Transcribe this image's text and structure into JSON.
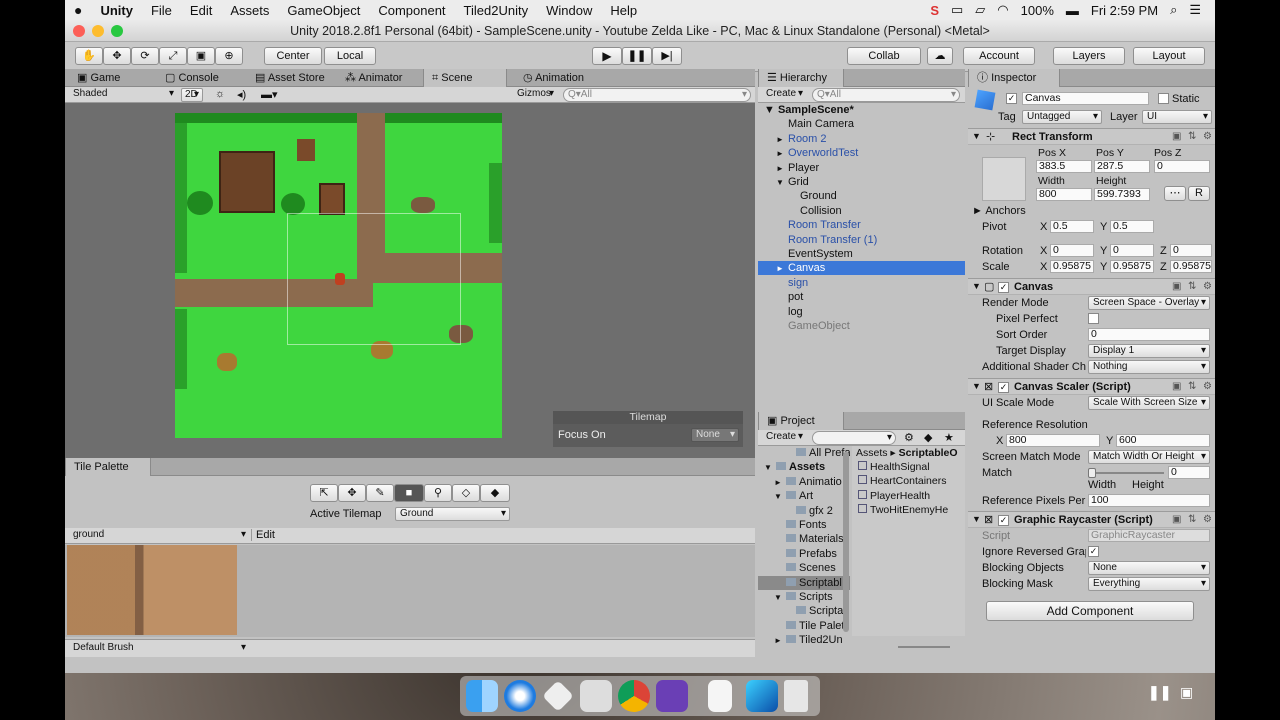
{
  "menubar": {
    "app": "Unity",
    "items": [
      "File",
      "Edit",
      "Assets",
      "GameObject",
      "Component",
      "Tiled2Unity",
      "Window",
      "Help"
    ],
    "battery": "100%",
    "clock": "Fri 2:59 PM"
  },
  "window": {
    "title": "Unity 2018.2.8f1 Personal (64bit) - SampleScene.unity - Youtube Zelda Like - PC, Mac & Linux Standalone (Personal) <Metal>"
  },
  "toolbar": {
    "center": "Center",
    "local": "Local",
    "collab": "Collab",
    "account": "Account",
    "layers": "Layers",
    "layout": "Layout"
  },
  "scene_panel": {
    "tabs": [
      "Game",
      "Console",
      "Asset Store",
      "Animator",
      "Scene",
      "Animation"
    ],
    "active_tab": "Scene",
    "shading": "Shaded",
    "mode_2d": "2D",
    "gizmos": "Gizmos",
    "search_placeholder": "Q▾All",
    "tilemap_title": "Tilemap",
    "focus_label": "Focus On",
    "focus_value": "None"
  },
  "tile_palette": {
    "tab": "Tile Palette",
    "active_tilemap_label": "Active Tilemap",
    "active_tilemap_value": "Ground",
    "palette_name": "ground",
    "edit": "Edit",
    "brush": "Default Brush"
  },
  "hierarchy": {
    "tab": "Hierarchy",
    "create": "Create",
    "search": "Q▾All",
    "scene": "SampleScene*",
    "items": [
      {
        "label": "Main Camera",
        "indent": 1,
        "style": "normal",
        "arrow": ""
      },
      {
        "label": "Room 2",
        "indent": 1,
        "style": "blue",
        "arrow": "►"
      },
      {
        "label": "OverworldTest",
        "indent": 1,
        "style": "blue",
        "arrow": "►"
      },
      {
        "label": "Player",
        "indent": 1,
        "style": "normal",
        "arrow": "►"
      },
      {
        "label": "Grid",
        "indent": 1,
        "style": "normal",
        "arrow": "▼"
      },
      {
        "label": "Ground",
        "indent": 2,
        "style": "normal",
        "arrow": ""
      },
      {
        "label": "Collision",
        "indent": 2,
        "style": "normal",
        "arrow": ""
      },
      {
        "label": "Room Transfer",
        "indent": 1,
        "style": "blue",
        "arrow": ""
      },
      {
        "label": "Room Transfer (1)",
        "indent": 1,
        "style": "blue",
        "arrow": ""
      },
      {
        "label": "EventSystem",
        "indent": 1,
        "style": "normal",
        "arrow": ""
      },
      {
        "label": "Canvas",
        "indent": 1,
        "style": "selected",
        "arrow": "►"
      },
      {
        "label": "sign",
        "indent": 1,
        "style": "blue",
        "arrow": ""
      },
      {
        "label": "pot",
        "indent": 1,
        "style": "normal",
        "arrow": ""
      },
      {
        "label": "log",
        "indent": 1,
        "style": "normal",
        "arrow": ""
      },
      {
        "label": "GameObject",
        "indent": 1,
        "style": "grey",
        "arrow": ""
      }
    ]
  },
  "project": {
    "tab": "Project",
    "create": "Create",
    "breadcrumb_root": "Assets",
    "breadcrumb_leaf": "ScriptableO",
    "tree": [
      {
        "label": "All Prefab",
        "indent": 2,
        "arrow": ""
      },
      {
        "label": "Assets",
        "indent": 0,
        "arrow": "▼",
        "bold": true
      },
      {
        "label": "Animatio",
        "indent": 1,
        "arrow": "►"
      },
      {
        "label": "Art",
        "indent": 1,
        "arrow": "▼"
      },
      {
        "label": "gfx 2",
        "indent": 2,
        "arrow": ""
      },
      {
        "label": "Fonts",
        "indent": 1,
        "arrow": ""
      },
      {
        "label": "Materials",
        "indent": 1,
        "arrow": ""
      },
      {
        "label": "Prefabs",
        "indent": 1,
        "arrow": ""
      },
      {
        "label": "Scenes",
        "indent": 1,
        "arrow": ""
      },
      {
        "label": "Scriptabl",
        "indent": 1,
        "arrow": "",
        "selected": true
      },
      {
        "label": "Scripts",
        "indent": 1,
        "arrow": "▼"
      },
      {
        "label": "Scripta",
        "indent": 2,
        "arrow": ""
      },
      {
        "label": "Tile Palet",
        "indent": 1,
        "arrow": ""
      },
      {
        "label": "Tiled2Un",
        "indent": 1,
        "arrow": "►"
      }
    ],
    "files": [
      "HealthSignal",
      "HeartContainers",
      "PlayerHealth",
      "TwoHitEnemyHe"
    ]
  },
  "inspector": {
    "tab": "Inspector",
    "name": "Canvas",
    "static": "Static",
    "tag_label": "Tag",
    "tag": "Untagged",
    "layer_label": "Layer",
    "layer": "UI",
    "rect_transform": {
      "title": "Rect Transform",
      "posx_l": "Pos X",
      "posy_l": "Pos Y",
      "posz_l": "Pos Z",
      "posx": "383.5",
      "posy": "287.5",
      "posz": "0",
      "width_l": "Width",
      "height_l": "Height",
      "width": "800",
      "height": "599.7393",
      "anchors": "Anchors",
      "pivot": "Pivot",
      "pivot_x": "0.5",
      "pivot_y": "0.5",
      "rotation": "Rotation",
      "rot_x": "0",
      "rot_y": "0",
      "rot_z": "0",
      "scale": "Scale",
      "scale_x": "0.95875",
      "scale_y": "0.95875",
      "scale_z": "0.95875",
      "X": "X",
      "Y": "Y",
      "Z": "Z",
      "R": "R"
    },
    "canvas": {
      "title": "Canvas",
      "render_mode_l": "Render Mode",
      "render_mode": "Screen Space - Overlay",
      "pixel_perfect": "Pixel Perfect",
      "sort_order_l": "Sort Order",
      "sort_order": "0",
      "target_display_l": "Target Display",
      "target_display": "Display 1",
      "shader_l": "Additional Shader Cha",
      "shader": "Nothing"
    },
    "scaler": {
      "title": "Canvas Scaler (Script)",
      "ui_scale_l": "UI Scale Mode",
      "ui_scale": "Scale With Screen Size",
      "ref_res": "Reference Resolution",
      "ref_x": "800",
      "ref_y": "600",
      "match_mode_l": "Screen Match Mode",
      "match_mode": "Match Width Or Height",
      "match_l": "Match",
      "match": "0",
      "match_value": 0,
      "width": "Width",
      "height": "Height",
      "ppu_l": "Reference Pixels Per U",
      "ppu": "100"
    },
    "raycaster": {
      "title": "Graphic Raycaster (Script)",
      "script_l": "Script",
      "script": "GraphicRaycaster",
      "ignore_l": "Ignore Reversed Grapl",
      "blocking_l": "Blocking Objects",
      "blocking": "None",
      "mask_l": "Blocking Mask",
      "mask": "Everything"
    },
    "add_component": "Add Component"
  }
}
